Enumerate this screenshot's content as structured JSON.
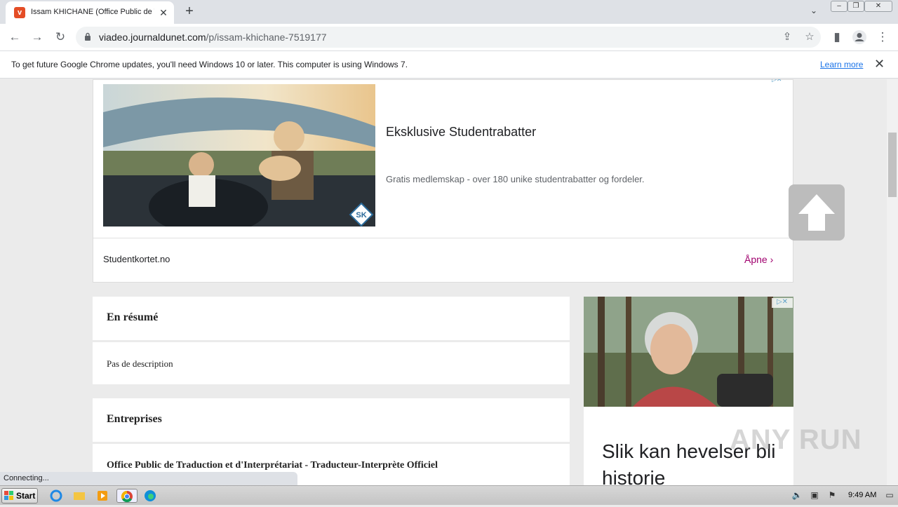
{
  "browser": {
    "tab_title": "Issam KHICHANE (Office Public de Tr",
    "favicon_letter": "v",
    "url_domain": "viadeo.journaldunet.com",
    "url_path": "/p/issam-khichane-7519177"
  },
  "infobar": {
    "message": "To get future Google Chrome updates, you'll need Windows 10 or later. This computer is using Windows 7.",
    "learn_more": "Learn more"
  },
  "ad_top": {
    "headline": "Eksklusive Studentrabatter",
    "description": "Gratis medlemskap - over 180 unike studentrabatter og fordeler.",
    "domain": "Studentkortet.no",
    "cta": "Åpne",
    "logo_text": "SK"
  },
  "profile": {
    "summary_heading": "En résumé",
    "summary_text": "Pas de description",
    "companies_heading": "Entreprises",
    "company_name": "Office Public de Traduction et d'Interprétariat - Traducteur-Interprète Officiel"
  },
  "ad_side": {
    "headline": "Slik kan hevelser bli historie"
  },
  "status_bar": "Connecting...",
  "watermark": "ANY RUN",
  "taskbar": {
    "start_label": "Start",
    "clock": "9:49 AM"
  },
  "colors": {
    "accent_link": "#1a73e8",
    "ad_cta": "#a0006e"
  }
}
